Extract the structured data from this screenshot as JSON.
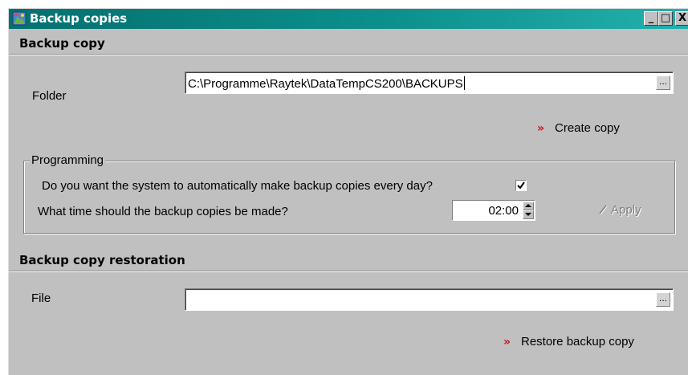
{
  "window": {
    "title": "Backup copies",
    "controls": {
      "minimize": "_",
      "maximize": "□",
      "close": "X"
    }
  },
  "backup": {
    "section_title": "Backup copy",
    "folder_label": "Folder",
    "folder_value": "C:\\Programme\\Raytek\\DataTempCS200\\BACKUPS",
    "browse_label": "...",
    "create_label": "Create copy"
  },
  "programming": {
    "group_title": "Programming",
    "auto_question": "Do you want the system to automatically make backup copies every day?",
    "auto_checked": true,
    "time_question": "What time should the backup copies be made?",
    "time_value": "02:00",
    "apply_label": "Apply",
    "apply_enabled": false
  },
  "restoration": {
    "section_title": "Backup copy restoration",
    "file_label": "File",
    "file_value": "",
    "browse_label": "...",
    "restore_label": "Restore backup copy"
  },
  "icons": {
    "app": "app-icon",
    "action_arrow": "»",
    "apply": "check-icon"
  },
  "colors": {
    "titlebar": "#0c8f8c",
    "face": "#c0c0c0",
    "action_arrow": "#c01818",
    "disabled_text": "#808080"
  }
}
